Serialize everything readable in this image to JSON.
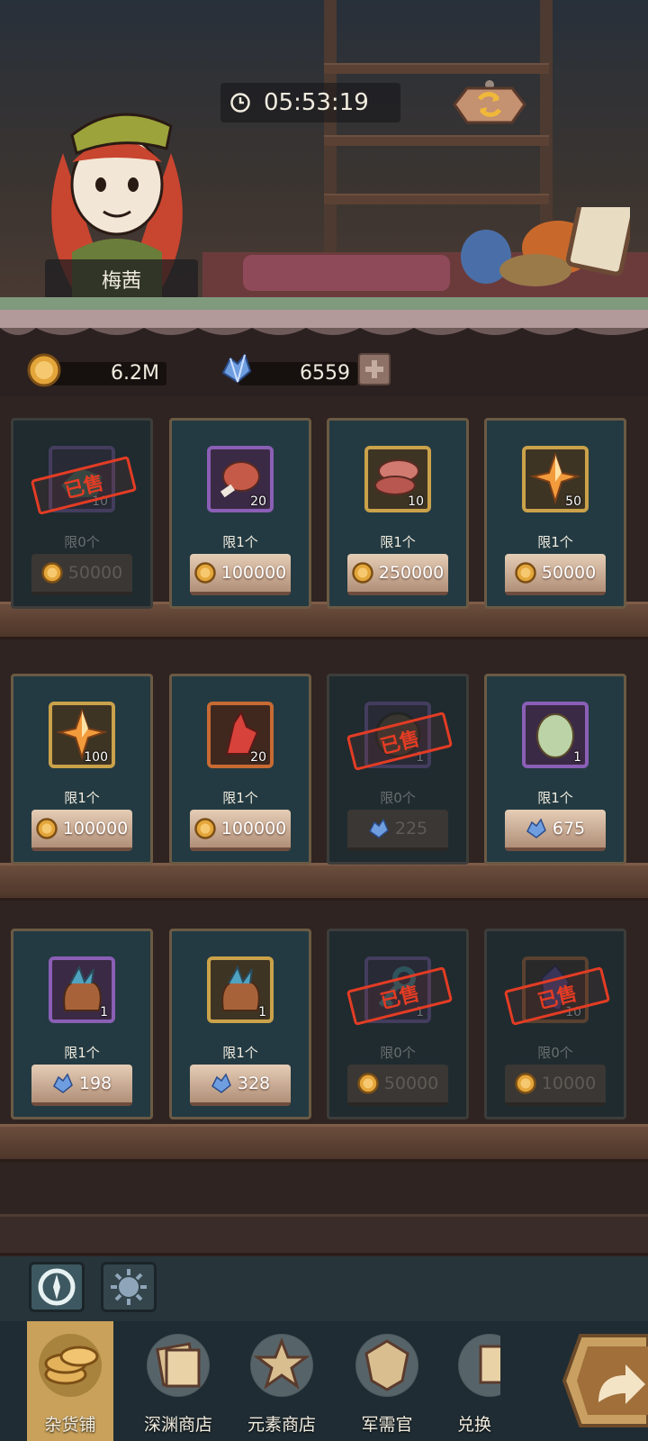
{
  "header": {
    "timer": "05:53:19",
    "clock_icon": "clock-icon",
    "refresh_icon": "refresh-icon",
    "shopkeeper_name": "梅茜"
  },
  "currency": {
    "gold": {
      "icon": "gold-coin-icon",
      "amount": "6.2M"
    },
    "gems": {
      "icon": "blue-crystal-icon",
      "amount": "6559",
      "add_icon": "plus-icon"
    }
  },
  "shop": {
    "sold_label": "已售",
    "items": [
      {
        "name": "green-fabric",
        "icon": "green-fabric-icon",
        "rarity": "purple",
        "qty": "10",
        "limit": "限0个",
        "price": "50000",
        "currency": "gold",
        "sold": true
      },
      {
        "name": "meat-leg",
        "icon": "meat-leg-icon",
        "rarity": "purple",
        "qty": "20",
        "limit": "限1个",
        "price": "100000",
        "currency": "gold",
        "sold": false
      },
      {
        "name": "sliced-meat",
        "icon": "sliced-meat-icon",
        "rarity": "gold",
        "qty": "10",
        "limit": "限1个",
        "price": "250000",
        "currency": "gold",
        "sold": false
      },
      {
        "name": "orange-crystal",
        "icon": "orange-crystal-icon",
        "rarity": "gold",
        "qty": "50",
        "limit": "限1个",
        "price": "50000",
        "currency": "gold",
        "sold": false
      },
      {
        "name": "orange-crystal-large",
        "icon": "orange-crystal-icon",
        "rarity": "gold",
        "qty": "100",
        "limit": "限1个",
        "price": "100000",
        "currency": "gold",
        "sold": false
      },
      {
        "name": "red-crystal",
        "icon": "red-crystal-icon",
        "rarity": "orange",
        "qty": "20",
        "limit": "限1个",
        "price": "100000",
        "currency": "gold",
        "sold": false
      },
      {
        "name": "wooden-shield",
        "icon": "shield-icon",
        "rarity": "purple",
        "qty": "1",
        "limit": "限0个",
        "price": "225",
        "currency": "gem",
        "sold": true
      },
      {
        "name": "green-egg",
        "icon": "egg-icon",
        "rarity": "purple",
        "qty": "1",
        "limit": "限1个",
        "price": "675",
        "currency": "gem",
        "sold": false
      },
      {
        "name": "gem-sack-purple",
        "icon": "gem-sack-icon",
        "rarity": "purple",
        "qty": "1",
        "limit": "限1个",
        "price": "198",
        "currency": "gem",
        "sold": false
      },
      {
        "name": "gem-sack-gold",
        "icon": "gem-sack-icon",
        "rarity": "gold",
        "qty": "1",
        "limit": "限1个",
        "price": "328",
        "currency": "gem",
        "sold": false
      },
      {
        "name": "blue-key",
        "icon": "key-icon",
        "rarity": "purple",
        "qty": "1",
        "limit": "限0个",
        "price": "50000",
        "currency": "gold",
        "sold": true
      },
      {
        "name": "purple-gem",
        "icon": "purple-gem-icon",
        "rarity": "orange",
        "qty": "10",
        "limit": "限0个",
        "price": "10000",
        "currency": "gold",
        "sold": true
      }
    ]
  },
  "subtabs": [
    {
      "icon": "compass-icon"
    },
    {
      "icon": "sun-icon"
    }
  ],
  "nav": [
    {
      "label": "杂货铺",
      "icon": "coins-icon",
      "active": true
    },
    {
      "label": "深渊商店",
      "icon": "cards-icon",
      "active": false
    },
    {
      "label": "元素商店",
      "icon": "star-emblem-icon",
      "active": false
    },
    {
      "label": "军需官",
      "icon": "badge-icon",
      "active": false
    },
    {
      "label": "兑换",
      "icon": "exchange-icon",
      "active": false
    }
  ],
  "colors": {
    "gold_frame": "#caa24a",
    "purple_frame": "#8a5fb5",
    "orange_frame": "#c76a34",
    "sold_stamp": "#e33c24"
  }
}
